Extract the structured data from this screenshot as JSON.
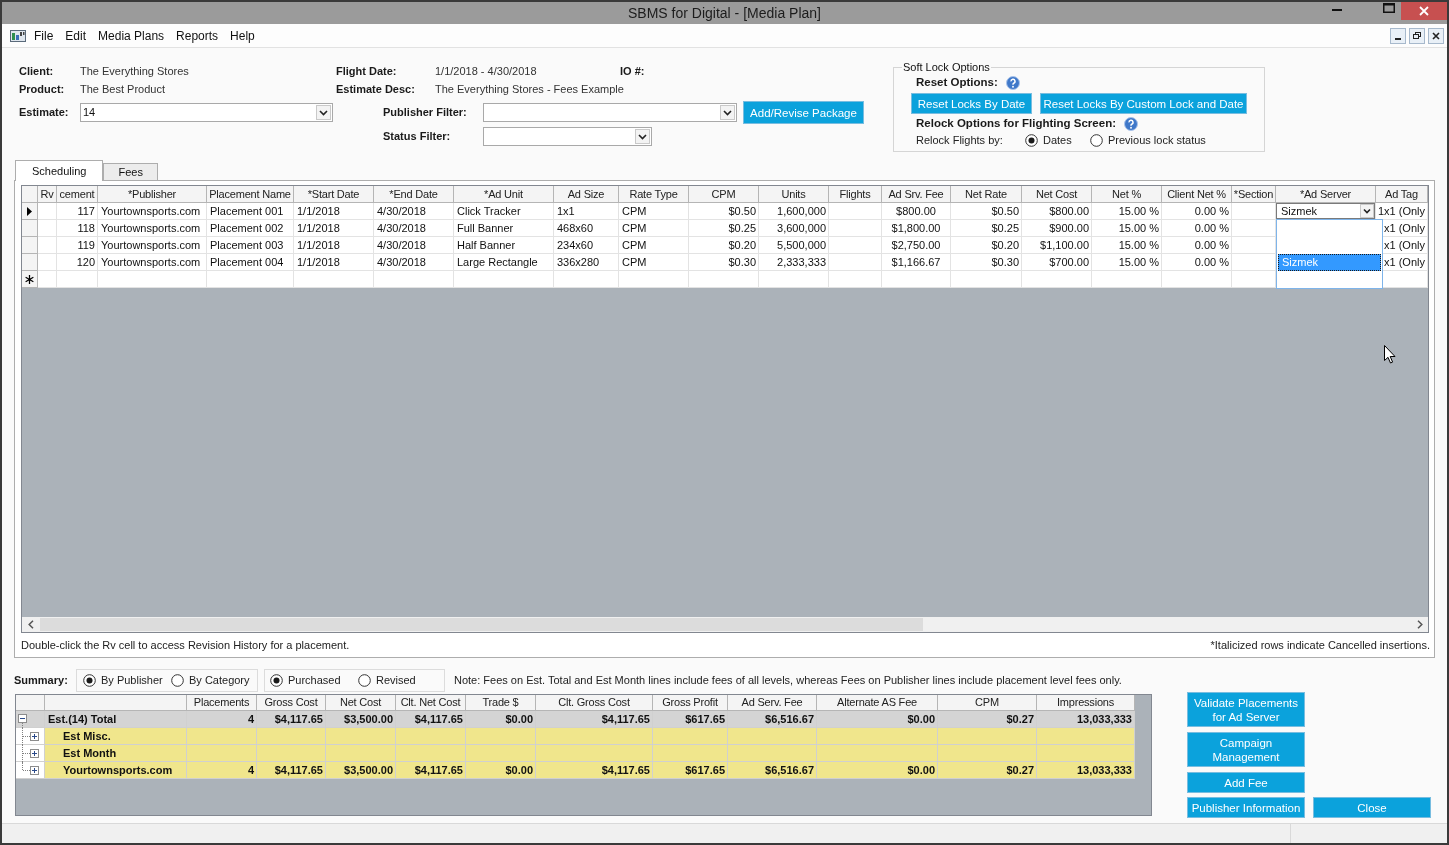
{
  "window": {
    "title": "SBMS for Digital - [Media Plan]"
  },
  "menu": [
    "File",
    "Edit",
    "Media Plans",
    "Reports",
    "Help"
  ],
  "header": {
    "client": {
      "label": "Client:",
      "value": "The Everything Stores"
    },
    "product": {
      "label": "Product:",
      "value": "The Best Product"
    },
    "estimate": {
      "label": "Estimate:",
      "value": "14"
    },
    "flight_date": {
      "label": "Flight Date:",
      "value": "1/1/2018 - 4/30/2018"
    },
    "estimate_desc": {
      "label": "Estimate Desc:",
      "value": "The Everything Stores - Fees Example"
    },
    "io_number": {
      "label": "IO #:"
    },
    "publisher_filter": {
      "label": "Publisher Filter:"
    },
    "status_filter": {
      "label": "Status Filter:"
    },
    "add_revise_button": "Add/Revise Package"
  },
  "soft_lock": {
    "title": "Soft Lock Options",
    "reset_label": "Reset Options:",
    "reset_buttons": [
      "Reset Locks By Date",
      "Reset Locks By Custom Lock and Date"
    ],
    "relock_label": "Relock Options for Flighting Screen:",
    "relock_by_label": "Relock Flights by:",
    "relock_options": [
      {
        "label": "Dates",
        "selected": true
      },
      {
        "label": "Previous lock status",
        "selected": false
      }
    ]
  },
  "tabs": [
    {
      "label": "Scheduling",
      "selected": true
    },
    {
      "label": "Fees",
      "selected": false
    }
  ],
  "schedule_table": {
    "columns": [
      "Rv",
      "cement",
      "*Publisher",
      "Placement Name",
      "*Start Date",
      "*End Date",
      "*Ad Unit",
      "Ad Size",
      "Rate Type",
      "CPM",
      "Units",
      "Flights",
      "Ad Srv. Fee",
      "Net Rate",
      "Net Cost",
      "Net %",
      "Client Net %",
      "*Section",
      "*Ad Server",
      "Ad Tag"
    ],
    "rows": [
      {
        "selected": true,
        "number": "117",
        "publisher": "Yourtownsports.com",
        "placement_name": "Placement 001",
        "start_date": "1/1/2018",
        "end_date": "4/30/2018",
        "ad_unit": "Click Tracker",
        "ad_size": "1x1",
        "rate_type": "CPM",
        "cpm": "$0.50",
        "units": "1,600,000",
        "ad_srv_fee": "$800.00",
        "net_rate": "$0.50",
        "net_cost": "$800.00",
        "net_pct": "15.00 %",
        "client_net_pct": "0.00 %",
        "ad_server_editor": {
          "value": "Sizmek",
          "expanded": true,
          "options": [
            {
              "label": "Sizmek",
              "selected": true
            }
          ]
        },
        "ad_tag": "1x1 (Only"
      },
      {
        "selected": false,
        "number": "118",
        "publisher": "Yourtownsports.com",
        "placement_name": "Placement 002",
        "start_date": "1/1/2018",
        "end_date": "4/30/2018",
        "ad_unit": "Full Banner",
        "ad_size": "468x60",
        "rate_type": "CPM",
        "cpm": "$0.25",
        "units": "3,600,000",
        "ad_srv_fee": "$1,800.00",
        "net_rate": "$0.25",
        "net_cost": "$900.00",
        "net_pct": "15.00 %",
        "client_net_pct": "0.00 %",
        "ad_tag": "x1 (Only"
      },
      {
        "selected": false,
        "number": "119",
        "publisher": "Yourtownsports.com",
        "placement_name": "Placement 003",
        "start_date": "1/1/2018",
        "end_date": "4/30/2018",
        "ad_unit": "Half Banner",
        "ad_size": "234x60",
        "rate_type": "CPM",
        "cpm": "$0.20",
        "units": "5,500,000",
        "ad_srv_fee": "$2,750.00",
        "net_rate": "$0.20",
        "net_cost": "$1,100.00",
        "net_pct": "15.00 %",
        "client_net_pct": "0.00 %",
        "ad_tag": "x1 (Only"
      },
      {
        "selected": false,
        "number": "120",
        "publisher": "Yourtownsports.com",
        "placement_name": "Placement 004",
        "start_date": "1/1/2018",
        "end_date": "4/30/2018",
        "ad_unit": "Large Rectangle",
        "ad_size": "336x280",
        "rate_type": "CPM",
        "cpm": "$0.30",
        "units": "2,333,333",
        "ad_srv_fee": "$1,166.67",
        "net_rate": "$0.30",
        "net_cost": "$700.00",
        "net_pct": "15.00 %",
        "client_net_pct": "0.00 %",
        "ad_tag": "x1 (Only"
      }
    ],
    "hint": "Double-click the Rv cell to access Revision History for a placement.",
    "legend_note": "*Italicized rows indicate Cancelled insertions."
  },
  "summary": {
    "label": "Summary:",
    "group_by": [
      {
        "label": "By Publisher",
        "selected": true
      },
      {
        "label": "By Category",
        "selected": false
      }
    ],
    "version": [
      {
        "label": "Purchased",
        "selected": true
      },
      {
        "label": "Revised",
        "selected": false
      }
    ],
    "note": "Note: Fees on Est. Total and Est Month lines include fees of all levels, whereas Fees on Publisher lines include placement level fees only.",
    "columns": [
      "Placements",
      "Gross Cost",
      "Net Cost",
      "Clt. Net Cost",
      "Trade $",
      "Clt. Gross Cost",
      "Gross Profit",
      "Ad Serv. Fee",
      "Alternate AS Fee",
      "CPM",
      "Impressions"
    ],
    "rows": [
      {
        "name": "Est.(14) Total",
        "expanded": true,
        "values": [
          "4",
          "$4,117.65",
          "$3,500.00",
          "$4,117.65",
          "$0.00",
          "$4,117.65",
          "$617.65",
          "$6,516.67",
          "$0.00",
          "$0.27",
          "13,033,333"
        ],
        "children": [
          {
            "name": "Est Misc.",
            "expanded": false
          },
          {
            "name": "Est Month",
            "expanded": false
          },
          {
            "name": "Yourtownsports.com",
            "expanded": false,
            "values": [
              "4",
              "$4,117.65",
              "$3,500.00",
              "$4,117.65",
              "$0.00",
              "$4,117.65",
              "$617.65",
              "$6,516.67",
              "$0.00",
              "$0.27",
              "13,033,333"
            ]
          }
        ]
      }
    ]
  },
  "action_buttons": [
    "Validate Placements for Ad Server",
    "Campaign Management",
    "Add Fee",
    "Publisher Information"
  ],
  "close_button": "Close"
}
